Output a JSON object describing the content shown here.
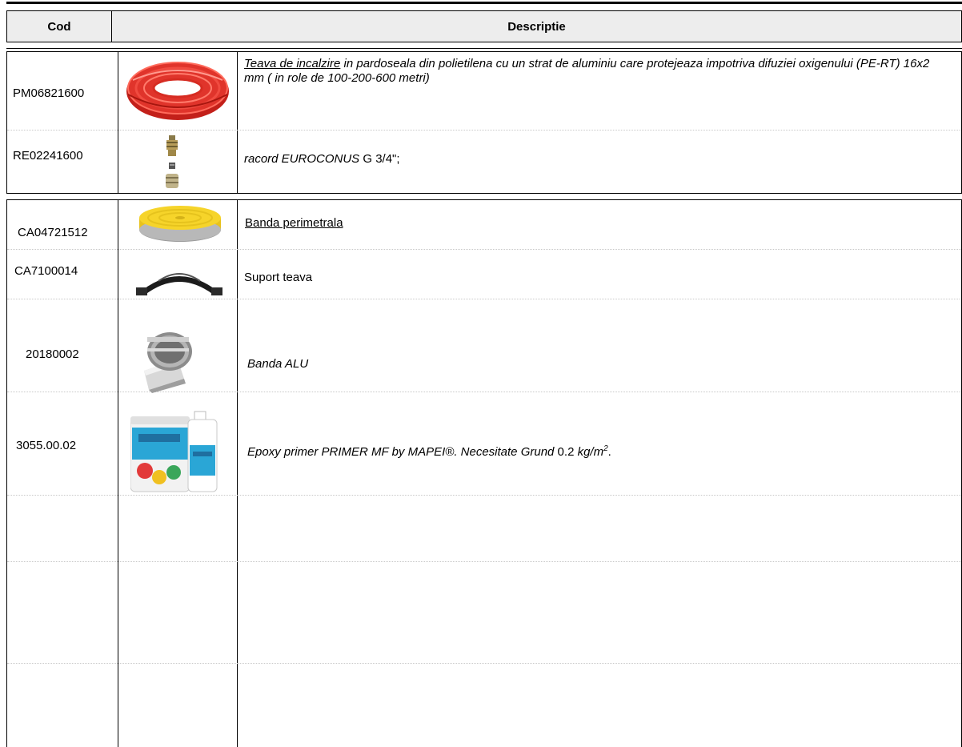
{
  "header": {
    "cod_label": "Cod",
    "desc_label": "Descriptie"
  },
  "rows": [
    {
      "code": "PM06821600",
      "image_icon": "red-pipe-coil-icon",
      "desc_link": "Teava de incalzire",
      "desc_rest": " in pardoseala din polietilena cu un strat de aluminiu care protejeaza impotriva difuziei oxigenului (PE-RT) 16x2 mm ( in role de 100-200-600 metri)"
    },
    {
      "code": "RE02241600",
      "image_icon": "brass-fitting-icon",
      "desc_italic": "racord EUROCONUS",
      "desc_rest": " G 3/4\";"
    },
    {
      "code": "CA04721512",
      "image_icon": "yellow-tape-roll-icon",
      "desc_underline": "Banda perimetrala"
    },
    {
      "code": "CA7100014",
      "image_icon": "pipe-bend-support-icon",
      "desc": "Suport teava"
    },
    {
      "code": "20180002",
      "image_icon": "alu-tape-roll-icon",
      "desc_italic": "Banda ALU"
    },
    {
      "code": "3055.00.02",
      "image_icon": "primer-bucket-icon",
      "desc_italic": "Epoxy primer PRIMER MF by MAPEI®. Necesitate Grund",
      "desc_value": " 0.2 ",
      "desc_unit_base": "kg/m",
      "desc_unit_sup": "2",
      "desc_end": "."
    }
  ]
}
